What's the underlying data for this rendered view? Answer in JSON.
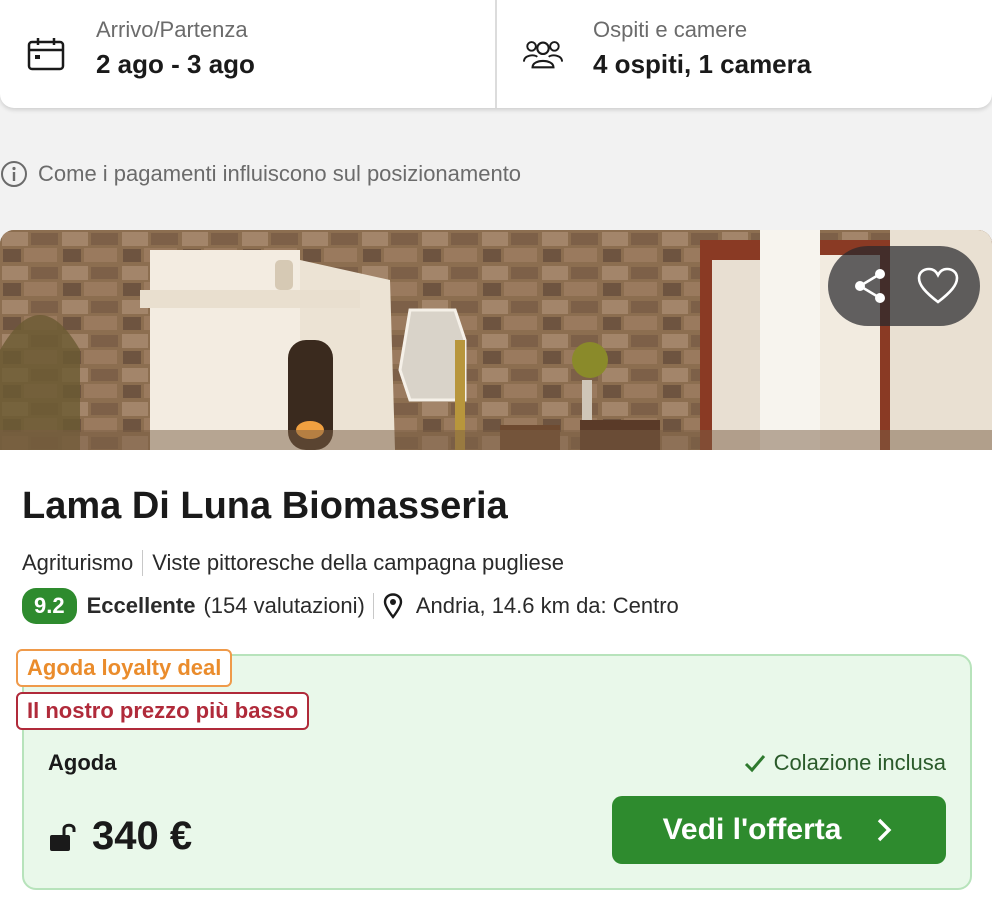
{
  "search": {
    "dates_label": "Arrivo/Partenza",
    "dates_value": "2 ago - 3 ago",
    "guests_label": "Ospiti e camere",
    "guests_value": "4 ospiti, 1 camera"
  },
  "info_text": "Come i pagamenti influiscono sul posizionamento",
  "hotel": {
    "name": "Lama Di Luna Biomasseria",
    "type": "Agriturismo",
    "highlight": "Viste pittoresche della campagna pugliese",
    "score": "9.2",
    "rating_word": "Eccellente",
    "reviews": "(154 valutazioni)",
    "location": "Andria, 14.6 km da: Centro"
  },
  "offer": {
    "tag_loyalty": "Agoda loyalty deal",
    "tag_lowest": "Il nostro prezzo più basso",
    "provider": "Agoda",
    "breakfast": "Colazione inclusa",
    "price": "340 €",
    "cta": "Vedi l'offerta"
  },
  "colors": {
    "accent_green": "#2e8b2e",
    "loyalty_orange": "#ea8c2c",
    "lowest_red": "#b02a3a",
    "offer_bg": "#e9f8ea"
  },
  "icons": {
    "dates": "calendar-icon",
    "guests": "people-icon",
    "info": "info-icon",
    "share": "share-icon",
    "favorite": "heart-icon",
    "location": "pin-icon",
    "breakfast": "check-icon",
    "price": "unlock-icon",
    "cta": "chevron-right-icon"
  }
}
